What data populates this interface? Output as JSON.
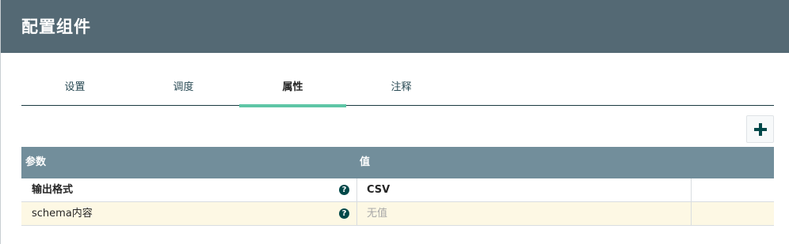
{
  "dialog": {
    "title": "配置组件"
  },
  "tabs": [
    {
      "label": "设置",
      "active": false
    },
    {
      "label": "调度",
      "active": false
    },
    {
      "label": "属性",
      "active": true
    },
    {
      "label": "注释",
      "active": false
    }
  ],
  "toolbar": {
    "add_icon": "plus-icon"
  },
  "table": {
    "columns": [
      "参数",
      "值"
    ],
    "rows": [
      {
        "name": "输出格式",
        "value": "CSV",
        "bold": true,
        "value_empty": false
      },
      {
        "name": "schema内容",
        "value": "无值",
        "bold": false,
        "value_empty": true
      }
    ]
  },
  "colors": {
    "header_bg": "#546974",
    "table_header_bg": "#728e9b",
    "active_tab_underline": "#5ec6a6",
    "alt_row_bg": "#fdf8e4",
    "help_icon": "#004849"
  }
}
